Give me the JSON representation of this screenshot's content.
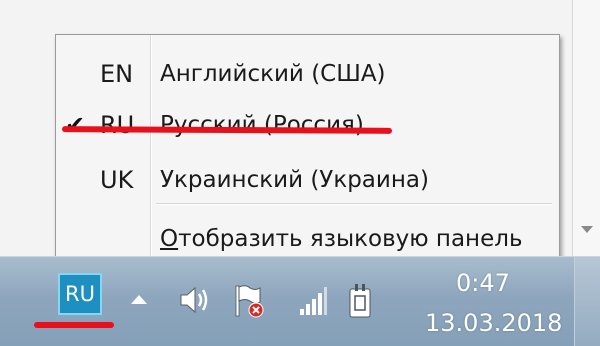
{
  "language_menu": {
    "items": [
      {
        "code": "EN",
        "label": "Английский (США)",
        "checked": false
      },
      {
        "code": "RU",
        "label": "Русский (Россия)",
        "checked": true
      },
      {
        "code": "UK",
        "label": "Украинский (Украина)",
        "checked": false
      }
    ],
    "check_glyph": "✔",
    "show_panel_underlined": "О",
    "show_panel_rest": "тобразить языковую панель"
  },
  "taskbar": {
    "language_indicator": "RU",
    "clock": {
      "time": "0:47",
      "date": "13.03.2018"
    },
    "tray_icons": [
      "show-hidden-icons-arrow",
      "speaker-icon",
      "action-center-flag-icon",
      "network-signal-icon",
      "power-plug-icon"
    ]
  },
  "colors": {
    "annotation_red": "#e8101b",
    "language_button_bg": "#1e8fc1",
    "taskbar": "#8ea6bd"
  }
}
